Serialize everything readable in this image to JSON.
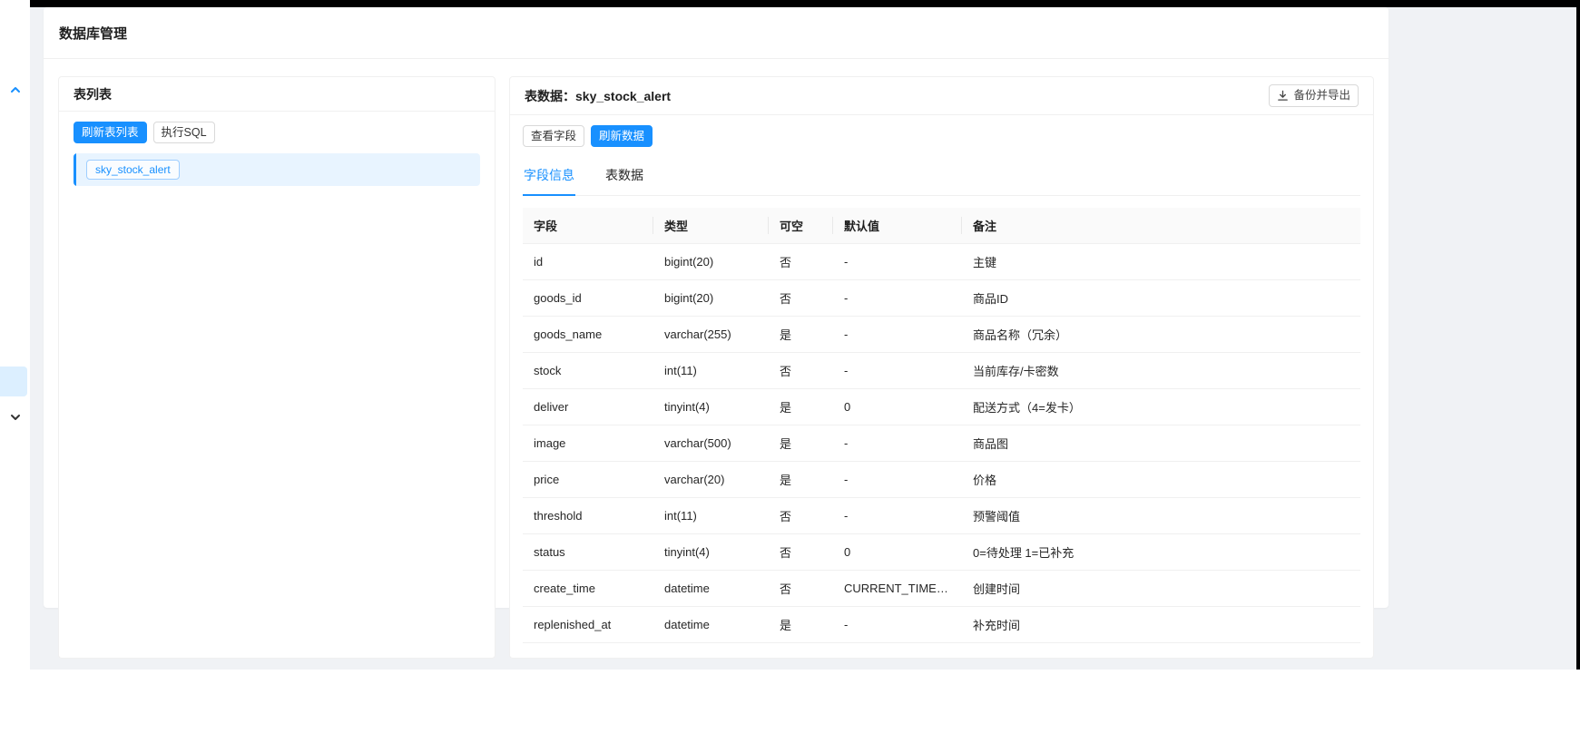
{
  "page": {
    "title": "数据库管理"
  },
  "sidebar": {
    "up_icon": "chevron-up-icon",
    "down_icon": "chevron-down-icon",
    "active_item": "collapsed-active-menu-item"
  },
  "table_list_panel": {
    "title": "表列表",
    "refresh_button": "刷新表列表",
    "execute_sql_button": "执行SQL",
    "tables": [
      "sky_stock_alert"
    ],
    "selected_table": "sky_stock_alert"
  },
  "table_data_panel": {
    "title_prefix": "表数据：",
    "table_name": "sky_stock_alert",
    "backup_export_button": "备份并导出",
    "backup_export_icon": "download-icon",
    "view_fields_button": "查看字段",
    "refresh_data_button": "刷新数据",
    "tabs": [
      {
        "name": "tab-field-info",
        "label": "字段信息",
        "active": true
      },
      {
        "name": "tab-table-data",
        "label": "表数据",
        "active": false
      }
    ],
    "fields_table": {
      "columns": [
        "字段",
        "类型",
        "可空",
        "默认值",
        "备注"
      ],
      "rows": [
        [
          "id",
          "bigint(20)",
          "否",
          "-",
          "主键"
        ],
        [
          "goods_id",
          "bigint(20)",
          "否",
          "-",
          "商品ID"
        ],
        [
          "goods_name",
          "varchar(255)",
          "是",
          "-",
          "商品名称（冗余）"
        ],
        [
          "stock",
          "int(11)",
          "否",
          "-",
          "当前库存/卡密数"
        ],
        [
          "deliver",
          "tinyint(4)",
          "是",
          "0",
          "配送方式（4=发卡）"
        ],
        [
          "image",
          "varchar(500)",
          "是",
          "-",
          "商品图"
        ],
        [
          "price",
          "varchar(20)",
          "是",
          "-",
          "价格"
        ],
        [
          "threshold",
          "int(11)",
          "否",
          "-",
          "预警阈值"
        ],
        [
          "status",
          "tinyint(4)",
          "否",
          "0",
          "0=待处理 1=已补充"
        ],
        [
          "create_time",
          "datetime",
          "否",
          "CURRENT_TIMESTAMP",
          "创建时间"
        ],
        [
          "replenished_at",
          "datetime",
          "是",
          "-",
          "补充时间"
        ]
      ]
    }
  },
  "colors": {
    "primary": "#1890ff",
    "page_background": "#f0f2f5",
    "frame": "#000000",
    "selected_row_background": "#e8f4ff",
    "table_header_background": "#fafafa",
    "border": "#f0f0f0"
  }
}
